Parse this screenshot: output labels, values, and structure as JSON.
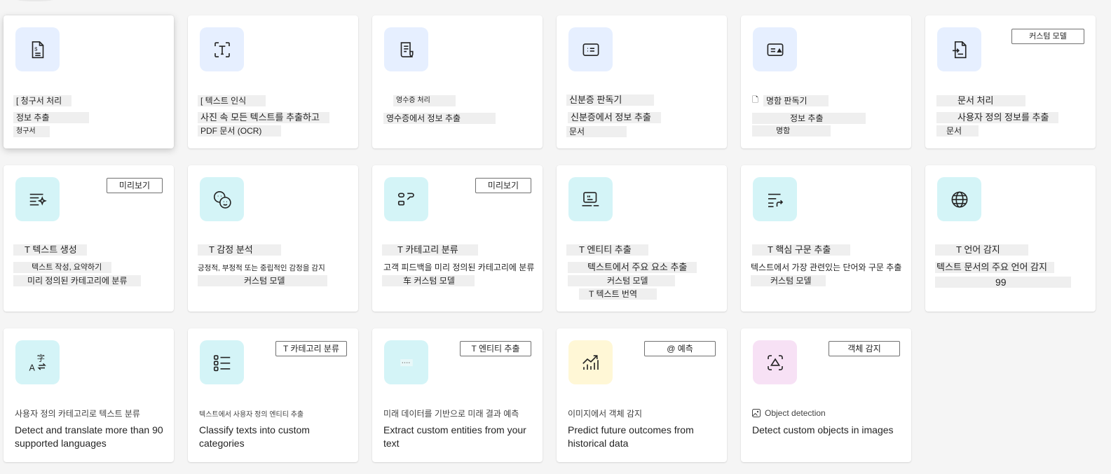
{
  "cards": [
    {
      "badge": "",
      "l1": "[ 청구서 처리",
      "l2": "정보 추출",
      "l3": "청구서",
      "icon": "invoice-icon"
    },
    {
      "badge": "",
      "l1": "[ 텍스트 인식",
      "l2": "사진 속 모든 텍스트를 추출하고",
      "l3": "PDF 문서 (OCR)",
      "icon": "text-recognition-icon"
    },
    {
      "badge": "",
      "l1": "영수증 처리",
      "l2": "영수증에서 정보 추출",
      "l3": "",
      "icon": "receipt-icon"
    },
    {
      "badge": "",
      "l1": "신분증 판독기",
      "l2": "신분증에서 정보 추출",
      "l3": "문서",
      "icon": "id-card-icon"
    },
    {
      "badge": "",
      "l1": "명함 판독기",
      "l2": "정보 추출",
      "l3": "명함",
      "icon": "business-card-icon"
    },
    {
      "badge": "커스텀 모델",
      "l1": "문서 처리",
      "l2": "사용자 정의 정보를 추출",
      "l3": "문서",
      "icon": "document-processing-icon"
    },
    {
      "badge": "미리보기",
      "l1": "T 텍스트 생성",
      "l2": "텍스트 작성, 요약하기",
      "l3": "미리 정의된 카테고리에 분류",
      "icon": "text-generation-icon"
    },
    {
      "badge": "",
      "l1": "T 감정 분석",
      "l2": "긍정적, 부정적 또는 중립적인 감정을 감지",
      "l3": "커스텀 모델",
      "icon": "sentiment-icon"
    },
    {
      "badge": "미리보기",
      "l1": "T 카테고리 분류",
      "l2": "고객 피드백을 미리 정의된 카테고리에 분류",
      "l3": "车 커스텀 모델",
      "icon": "category-icon"
    },
    {
      "badge": "",
      "l1": "T 엔티티 추출",
      "l2": "텍스트에서 주요 요소 추출",
      "l3": "커스텀 모델",
      "l4": "T 텍스트 번역",
      "icon": "entity-icon"
    },
    {
      "badge": "",
      "l1": "T 핵심 구문 추출",
      "l2": "텍스트에서 가장 관련있는 단어와 구문 추출",
      "l3": "커스텀 모델",
      "icon": "key-phrase-icon"
    },
    {
      "badge": "",
      "l1": "T 언어 감지",
      "l2": "텍스트 문서의 주요 언어 감지",
      "l3": "99",
      "icon": "globe-icon"
    },
    {
      "badge": "",
      "tag": "사용자 정의 카테고리로 텍스트 분류",
      "desc": "Detect and translate more than 90 supported languages",
      "icon": "translate-icon"
    },
    {
      "badge": "T 카테고리 분류",
      "tag": "텍스트에서 사용자 정의 엔티티 추출",
      "desc": "Classify texts into custom categories",
      "icon": "list-icon"
    },
    {
      "badge": "T 엔티티 추출",
      "tag": "미래 데이터를 기반으로 미래 결과 예측",
      "desc": "Extract custom entities from your text",
      "icon": "entity-extraction-icon"
    },
    {
      "badge": "@ 예측",
      "tag": "이미지에서 객체 감지",
      "desc": "Predict future outcomes from historical data",
      "icon": "chart-icon"
    },
    {
      "badge": "객체 감지",
      "tag": "Object detection",
      "desc": "Detect custom objects in images",
      "icon": "object-detection-icon"
    }
  ]
}
